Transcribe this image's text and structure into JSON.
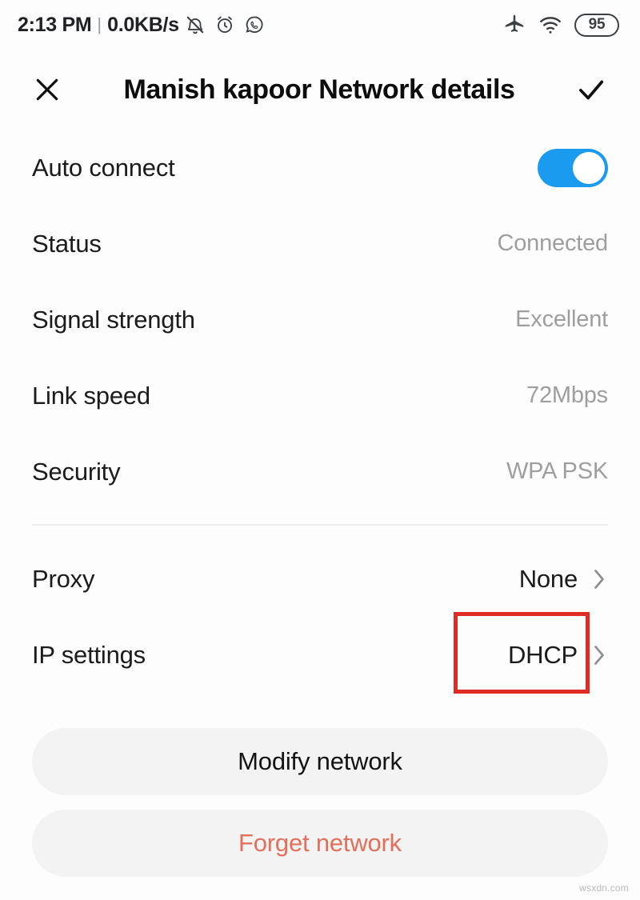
{
  "statusbar": {
    "time": "2:13 PM",
    "separator": "|",
    "data_rate": "0.0KB/s",
    "left_icons": [
      "notification-muted-icon",
      "alarm-clock-icon",
      "whatsapp-icon"
    ],
    "right_icons": [
      "airplane-mode-icon",
      "wifi-icon"
    ],
    "battery_level": "95"
  },
  "header": {
    "close_icon": "close-icon",
    "title": "Manish kapoor Network details",
    "confirm_icon": "check-icon"
  },
  "rows": [
    {
      "label": "Auto connect",
      "value": "",
      "type": "toggle",
      "toggle_on": true
    },
    {
      "label": "Status",
      "value": "Connected",
      "type": "text"
    },
    {
      "label": "Signal strength",
      "value": "Excellent",
      "type": "text"
    },
    {
      "label": "Link speed",
      "value": "72Mbps",
      "type": "text"
    },
    {
      "label": "Security",
      "value": "WPA PSK",
      "type": "text"
    }
  ],
  "settings_rows": [
    {
      "label": "Proxy",
      "value": "None",
      "type": "nav",
      "highlighted": false
    },
    {
      "label": "IP settings",
      "value": "DHCP",
      "type": "nav",
      "highlighted": true
    }
  ],
  "buttons": {
    "modify": "Modify network",
    "forget": "Forget network"
  },
  "watermark": "wsxdn.com",
  "colors": {
    "toggle_on": "#1a9bf0",
    "highlight_border": "#e02b22",
    "forget_text": "#e3705a",
    "value_text": "#9e9e9e",
    "label_text": "#1b1b1b",
    "button_background": "#f3f3f4"
  }
}
